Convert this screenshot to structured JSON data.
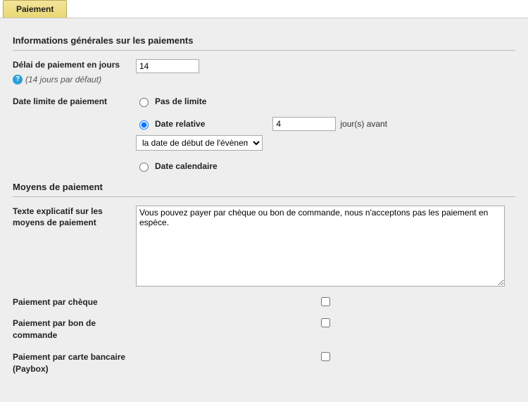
{
  "tab": {
    "label": "Paiement"
  },
  "section1": {
    "title": "Informations générales sur les paiements",
    "delay_label": "Délai de paiement en jours",
    "delay_value": "14",
    "delay_hint": "(14 jours par défaut)",
    "deadline_label": "Date limite de paiement",
    "radio_none": "Pas de limite",
    "radio_relative": "Date relative",
    "relative_value": "4",
    "relative_text": "jour(s) avant",
    "relative_select": "la date de début de l'évènement",
    "radio_calendar": "Date calendaire"
  },
  "section2": {
    "title": "Moyens de paiement",
    "text_label": "Texte explicatif sur les moyens de paiement",
    "text_value": "Vous pouvez payer par chèque ou bon de commande, nous n'acceptons pas les paiement en espèce.",
    "cheque_label": "Paiement par chèque",
    "bon_label": "Paiement par bon de commande",
    "paybox_label": "Paiement par carte bancaire (Paybox)"
  }
}
